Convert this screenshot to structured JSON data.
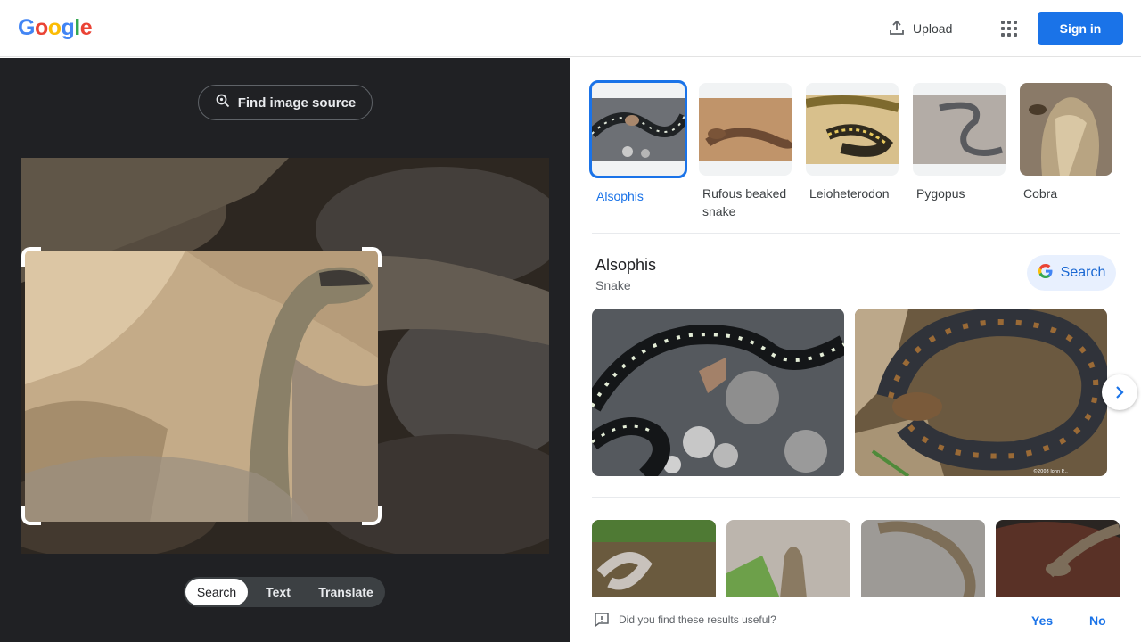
{
  "header": {
    "logo_text": "Google",
    "upload_label": "Upload",
    "apps_icon": "apps-grid-icon",
    "signin_label": "Sign in"
  },
  "lens": {
    "find_source_label": "Find image source",
    "modes": [
      {
        "label": "Search",
        "active": true
      },
      {
        "label": "Text",
        "active": false
      },
      {
        "label": "Translate",
        "active": false
      }
    ]
  },
  "results": {
    "candidates": [
      {
        "label": "Alsophis",
        "selected": true
      },
      {
        "label": "Rufous beaked snake",
        "selected": false
      },
      {
        "label": "Leioheterodon",
        "selected": false
      },
      {
        "label": "Pygopus",
        "selected": false
      },
      {
        "label": "Cobra",
        "selected": false
      }
    ],
    "entity_title": "Alsophis",
    "entity_subtitle": "Snake",
    "search_button_label": "Search",
    "watermark": "©2008 John P...",
    "feedback": {
      "question": "Did you find these results useful?",
      "yes": "Yes",
      "no": "No"
    }
  },
  "colors": {
    "accent": "#1a73e8",
    "dark_panel": "#202124"
  }
}
